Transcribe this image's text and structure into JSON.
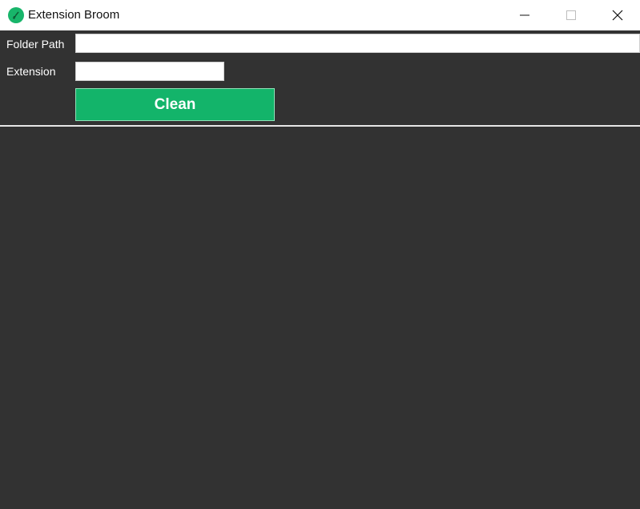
{
  "window": {
    "title": "Extension Broom",
    "icon": "broom-app-icon",
    "controls": [
      "minimize-icon",
      "maximize-icon",
      "close-icon"
    ]
  },
  "form": {
    "folder_label": "Folder Path",
    "folder_value": "",
    "extension_label": "Extension",
    "extension_value": "",
    "clean_label": "Clean"
  },
  "colors": {
    "background": "#323232",
    "accent": "#13b46a",
    "text": "#ffffff"
  }
}
